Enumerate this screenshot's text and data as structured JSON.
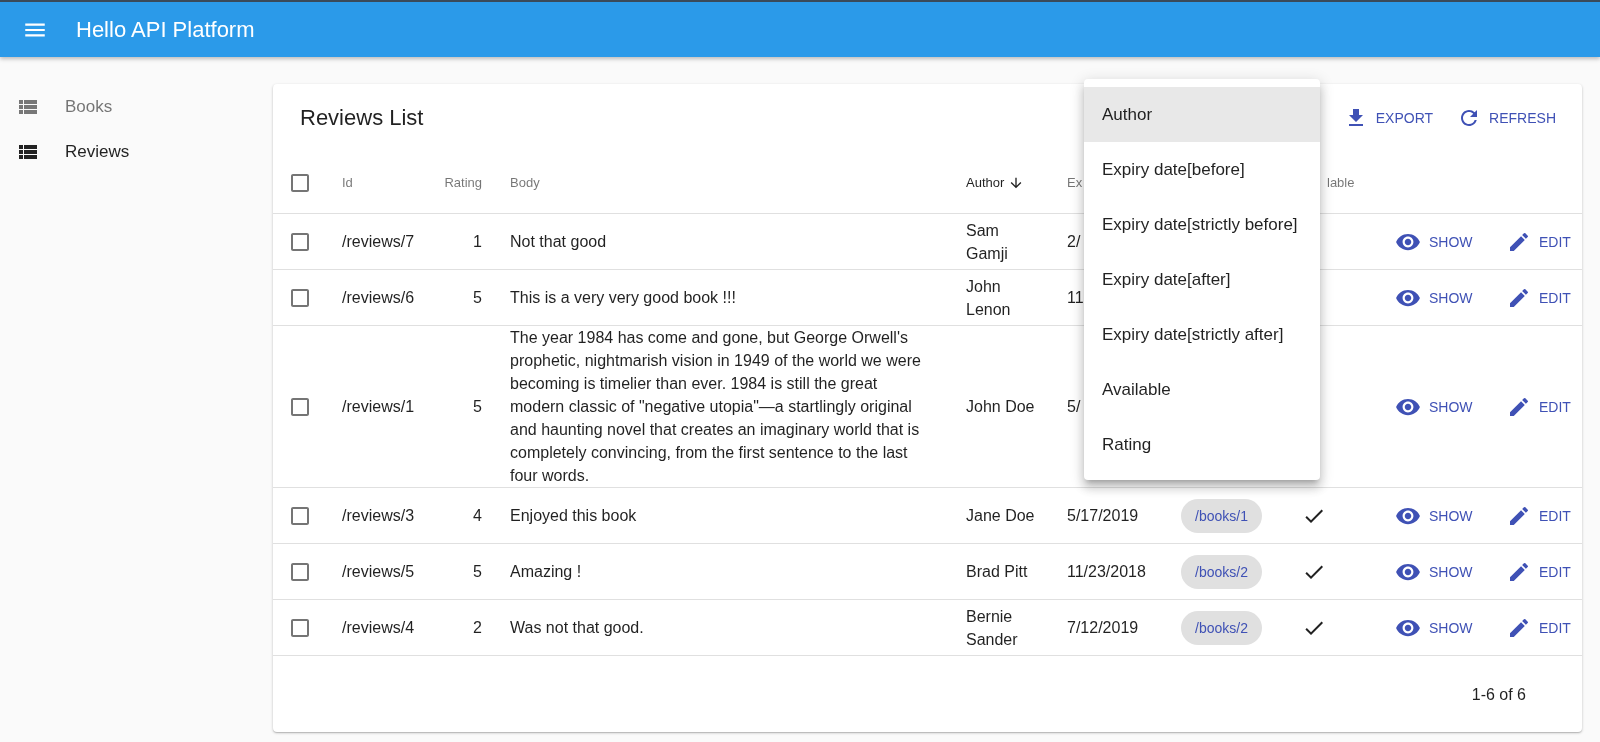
{
  "app_bar": {
    "title": "Hello API Platform"
  },
  "sidebar": {
    "items": [
      {
        "label": "Books",
        "selected": false
      },
      {
        "label": "Reviews",
        "selected": true
      }
    ]
  },
  "list": {
    "title": "Reviews List",
    "actions": [
      {
        "kind": "export",
        "label": "EXPORT"
      },
      {
        "kind": "refresh",
        "label": "REFRESH"
      }
    ],
    "select_all": {
      "checked": false
    },
    "columns": [
      {
        "kind": "id",
        "label": "Id",
        "sorted": false
      },
      {
        "kind": "rating",
        "label": "Rating",
        "sorted": false
      },
      {
        "kind": "body",
        "label": "Body",
        "sorted": false
      },
      {
        "kind": "author",
        "label": "Author",
        "sorted": true
      },
      {
        "kind": "expiry",
        "label": "Ex",
        "sorted": false
      },
      {
        "kind": "available",
        "label": "lable",
        "sorted": false
      }
    ],
    "rows": [
      {
        "checked": false,
        "id": "/reviews/7",
        "rating": "1",
        "body": "Not that good",
        "author": "Sam Gamji",
        "expiry": "2/",
        "show": "SHOW",
        "edit": "EDIT"
      },
      {
        "checked": false,
        "id": "/reviews/6",
        "rating": "5",
        "body": "This is a very very good book !!!",
        "author": "John Lenon",
        "expiry": "11",
        "show": "SHOW",
        "edit": "EDIT"
      },
      {
        "checked": false,
        "id": "/reviews/1",
        "rating": "5",
        "body": "The year 1984 has come and gone, but George Orwell's prophetic, nightmarish vision in 1949 of the world we were becoming is timelier than ever. 1984 is still the great modern classic of \"negative utopia\"—a startlingly original and haunting novel that creates an imaginary world that is completely convincing, from the first sentence to the last four words.",
        "author": "John Doe",
        "expiry": "5/",
        "show": "SHOW",
        "edit": "EDIT"
      },
      {
        "checked": false,
        "id": "/reviews/3",
        "rating": "4",
        "body": "Enjoyed this book",
        "author": "Jane Doe",
        "expiry": "5/17/2019",
        "book": "/books/1",
        "available": true,
        "show": "SHOW",
        "edit": "EDIT"
      },
      {
        "checked": false,
        "id": "/reviews/5",
        "rating": "5",
        "body": "Amazing !",
        "author": "Brad Pitt",
        "expiry": "11/23/2018",
        "book": "/books/2",
        "available": true,
        "show": "SHOW",
        "edit": "EDIT"
      },
      {
        "checked": false,
        "id": "/reviews/4",
        "rating": "2",
        "body": "Was not that good.",
        "author": "Bernie Sander",
        "expiry": "7/12/2019",
        "book": "/books/2",
        "available": true,
        "show": "SHOW",
        "edit": "EDIT"
      }
    ],
    "pagination": "1-6 of 6"
  },
  "filter_menu": {
    "items": [
      {
        "label": "Author",
        "selected": true
      },
      {
        "label": "Expiry date[before]",
        "selected": false
      },
      {
        "label": "Expiry date[strictly before]",
        "selected": false
      },
      {
        "label": "Expiry date[after]",
        "selected": false
      },
      {
        "label": "Expiry date[strictly after]",
        "selected": false
      },
      {
        "label": "Available",
        "selected": false
      },
      {
        "label": "Rating",
        "selected": false
      }
    ]
  }
}
